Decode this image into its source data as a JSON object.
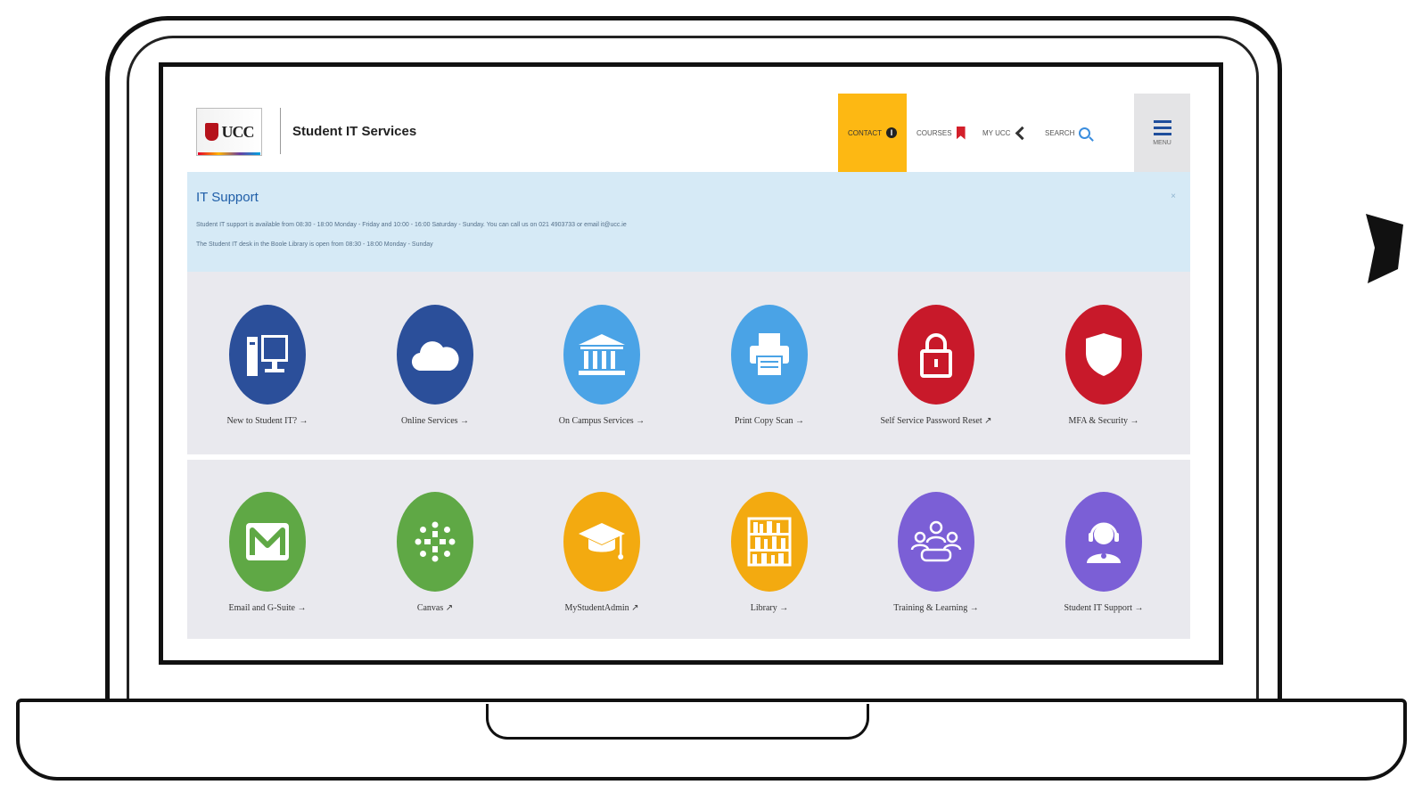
{
  "header": {
    "title": "Student IT Services",
    "logo_text": "UCC",
    "nav": [
      {
        "label": "Contact",
        "icon": "info-icon"
      },
      {
        "label": "Courses",
        "icon": "bookmark-icon"
      },
      {
        "label": "My UCC",
        "icon": "chevron-left-icon"
      },
      {
        "label": "Search",
        "icon": "search-icon"
      }
    ],
    "menu_label": "MENU"
  },
  "alert": {
    "title": "IT Support",
    "close": "×",
    "line1": "Student IT support is available from 08:30 - 18:00 Monday - Friday and 10:00 - 16:00 Saturday - Sunday. You can call us on 021 4903733 or email it@ucc.ie",
    "line2": "The Student IT desk in the Boole Library is open from 08:30 - 18:00 Monday - Sunday"
  },
  "tiles": [
    {
      "label": "New to Student IT? →",
      "icon": "computer-icon",
      "color": "#2b4f9a"
    },
    {
      "label": "Online Services →",
      "icon": "cloud-icon",
      "color": "#2b4f9a"
    },
    {
      "label": "On Campus Services →",
      "icon": "building-icon",
      "color": "#4aa3e6"
    },
    {
      "label": "Print Copy Scan →",
      "icon": "printer-icon",
      "color": "#4aa3e6"
    },
    {
      "label": "Self Service Password Reset ↗",
      "icon": "padlock-icon",
      "color": "#c8192a"
    },
    {
      "label": "MFA & Security →",
      "icon": "shield-icon",
      "color": "#c8192a"
    },
    {
      "label": "Email and G-Suite →",
      "icon": "gmail-icon",
      "color": "#5fa845"
    },
    {
      "label": "Canvas ↗",
      "icon": "canvas-icon",
      "color": "#5fa845"
    },
    {
      "label": "MyStudentAdmin ↗",
      "icon": "graduation-cap-icon",
      "color": "#f3aa10"
    },
    {
      "label": "Library →",
      "icon": "bookshelf-icon",
      "color": "#f3aa10"
    },
    {
      "label": "Training & Learning →",
      "icon": "group-icon",
      "color": "#7b5fd6"
    },
    {
      "label": "Student IT Support →",
      "icon": "support-agent-icon",
      "color": "#7b5fd6"
    }
  ]
}
